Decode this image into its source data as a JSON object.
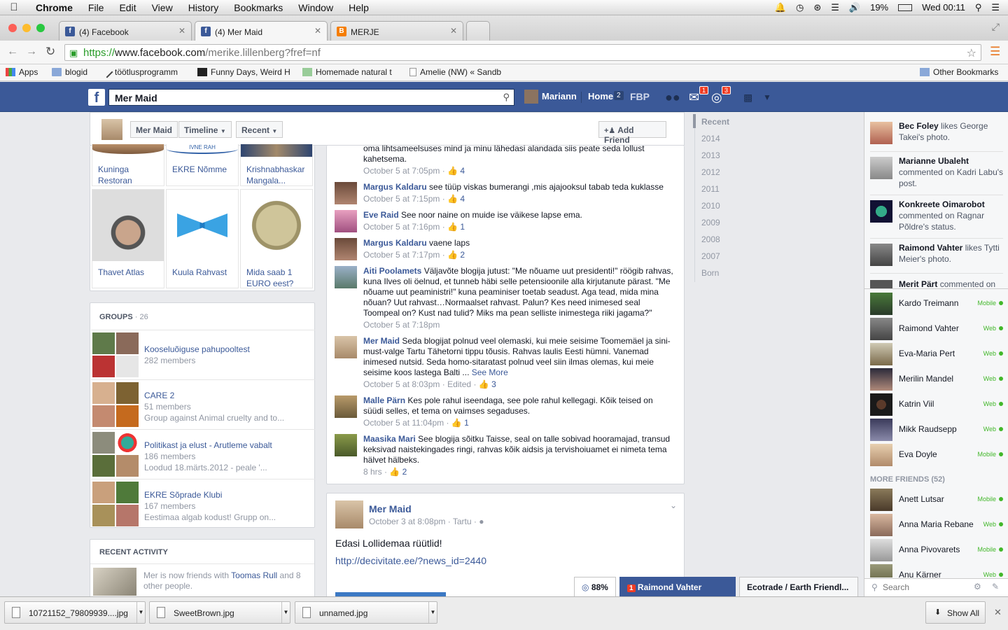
{
  "mac_menu": {
    "app": "Chrome",
    "items": [
      "File",
      "Edit",
      "View",
      "History",
      "Bookmarks",
      "Window",
      "Help"
    ],
    "battery": "19%",
    "clock": "Wed 00:11"
  },
  "tabs": [
    {
      "title": "(4) Facebook",
      "favicon": "f"
    },
    {
      "title": "(4) Mer Maid",
      "favicon": "f"
    },
    {
      "title": "MERJE",
      "favicon": "B"
    }
  ],
  "address": {
    "scheme": "https://",
    "host": "www.facebook.com",
    "path": "/merike.lillenberg?fref=nf"
  },
  "bookmarks": {
    "items": [
      "Apps",
      "blogid",
      "töötlusprogramm",
      "Funny Days, Weird H",
      "Homemade natural t",
      "Amelie (NW) « Sandb"
    ],
    "other": "Other Bookmarks"
  },
  "fb_header": {
    "search_value": "Mer Maid",
    "user": "Mariann",
    "home": "Home",
    "home_count": "2",
    "fbp": "FBP",
    "messages_count": "1",
    "notifications_count": "3"
  },
  "timeline_header": {
    "name": "Mer Maid",
    "timeline": "Timeline",
    "recent": "Recent",
    "add_friend": "Add Friend"
  },
  "photos_top": [
    {
      "caption": "Kuninga Restoran"
    },
    {
      "caption": "EKRE Nõmme"
    },
    {
      "caption": "Krishnabhaskar Mangala..."
    }
  ],
  "photos_bottom": [
    {
      "caption": "Thavet Atlas"
    },
    {
      "caption": "Kuula Rahvast"
    },
    {
      "caption": "Mida saab 1 EURO eest?"
    }
  ],
  "groups": {
    "title": "GROUPS",
    "count": "· 26",
    "items": [
      {
        "name": "Kooseluõiguse pahupoolt­est",
        "members": "282 members",
        "desc": ""
      },
      {
        "name": "CARE 2",
        "members": "51 members",
        "desc": "Group against Animal cruelty and to..."
      },
      {
        "name": "Politikast ja elust - Arutleme vabalt",
        "members": "186 members",
        "desc": "Loodud 18.märts.2012 - peale '..."
      },
      {
        "name": "EKRE Sõprade Klubi",
        "members": "167 members",
        "desc": "Eestimaa algab kodust! Grupp on..."
      }
    ]
  },
  "recent_activity": {
    "title": "RECENT ACTIVITY",
    "pre": "Mer is now friends with ",
    "link": "Toomas Rull",
    "post": " and 8 other people."
  },
  "comments": [
    {
      "name": "",
      "text": "oma lihtsameelsuses mind ja minu lähedasi alandada siis peate seda lollust kahetsema.",
      "time": "October 5 at 7:05pm",
      "likes": "4"
    },
    {
      "name": "Margus Kaldaru",
      "text": "see tüüp viskas bumerangi ,mis ajajooksul tabab teda kuklasse",
      "time": "October 5 at 7:15pm",
      "likes": "4"
    },
    {
      "name": "Eve Raid",
      "text": "See noor naine on muide ise väikese lapse ema.",
      "time": "October 5 at 7:16pm",
      "likes": "1"
    },
    {
      "name": "Margus Kaldaru",
      "text": "vaene laps",
      "time": "October 5 at 7:17pm",
      "likes": "2"
    },
    {
      "name": "Aiti Poolamets",
      "text": "Väljavõte blogija jutust: \"Me nõuame uut presidenti!\" röögib rahvas, kuna Ilves oli öelnud, et tunneb häbi selle petensioonile alla kirjutanute pärast. \"Me nõuame uut peaministri!\" kuna peaminiser toetab seadust. Aga tead, mida mina nõuan? Uut rahvast…Normaalset rahvast. Palun? Kes need inimesed seal Toompeal on? Kust nad tulid? Miks ma pean selliste inimestega riiki jagama?\"",
      "time": "October 5 at 7:18pm",
      "likes": ""
    },
    {
      "name": "Mer Maid",
      "text": "Seda blogijat polnud veel olemaski, kui meie seisime Toomemäel ja sini-must-valge Tartu Tähetorni tippu tõusis. Rahvas laulis Eesti hümni. Vanemad inimesed nutsid. Seda homo-sitaratast polnud veel siin ilmas olemas, kui meie seisime koos lastega Balti ...",
      "see_more": "See More",
      "time": "October 5 at 8:03pm",
      "edited": "Edited",
      "likes": "3"
    },
    {
      "name": "Malle Pärn",
      "text": "Kes pole rahul iseendaga, see pole rahul kellegagi. Kõik teised on süüdi selles, et tema on vaimses segaduses.",
      "time": "October 5 at 11:04pm",
      "likes": "1"
    },
    {
      "name": "Maasika Mari",
      "text": "See blogija sõitku Taisse, seal on talle sobivad hooramajad, transud keksivad naistekingades ringi, rahvas kõik aidsis ja tervishoiuamet ei nimeta tema hälvet hälbeks.",
      "time": "8 hrs",
      "likes": "2"
    }
  ],
  "post": {
    "author": "Mer Maid",
    "time": "October 3 at 8:08pm",
    "place": "Tartu",
    "text": "Edasi Lollidemaa rüütlid!",
    "link": "http://decivitate.ee/?news_id=2440"
  },
  "years": [
    "Recent",
    "2014",
    "2013",
    "2012",
    "2011",
    "2010",
    "2009",
    "2008",
    "2007",
    "Born"
  ],
  "ticker": [
    {
      "name": "Bec Foley",
      "text": " likes George Takei's photo."
    },
    {
      "name": "Marianne Ubaleht",
      "text": " commented on Kadri Labu's post."
    },
    {
      "name": "Konkreete Oimarobot",
      "text": " commented on Ragnar Põldre's status."
    },
    {
      "name": "Raimond Vahter",
      "text": " likes Tytti Meier's photo."
    },
    {
      "name": "Merit Pärt",
      "text": " commented on"
    }
  ],
  "chat_friends": [
    {
      "name": "Kardo Treimann",
      "status": "Mobile"
    },
    {
      "name": "Raimond Vahter",
      "status": "Web"
    },
    {
      "name": "Eva-Maria Pert",
      "status": "Web"
    },
    {
      "name": "Merilin Mandel",
      "status": "Web"
    },
    {
      "name": "Katrin Viil",
      "status": "Web"
    },
    {
      "name": "Mikk Raudsepp",
      "status": "Web"
    },
    {
      "name": "Eva Doyle",
      "status": "Mobile"
    }
  ],
  "more_friends": {
    "title": "MORE FRIENDS (52)",
    "items": [
      {
        "name": "Anett Lutsar",
        "status": "Mobile"
      },
      {
        "name": "Anna Maria Rebane",
        "status": "Web"
      },
      {
        "name": "Anna Pivovarets",
        "status": "Mobile"
      },
      {
        "name": "Anu Kärner",
        "status": "Web"
      }
    ]
  },
  "chat_search_placeholder": "Search",
  "chat_tabs": {
    "zoom": "88%",
    "active_count": "1",
    "active_name": "Raimond Vahter",
    "other": "Ecotrade / Earth Friendl..."
  },
  "downloads": {
    "items": [
      "10721152_79809939....jpg",
      "SweetBrown.jpg",
      "unnamed.jpg"
    ],
    "show_all": "Show All"
  }
}
